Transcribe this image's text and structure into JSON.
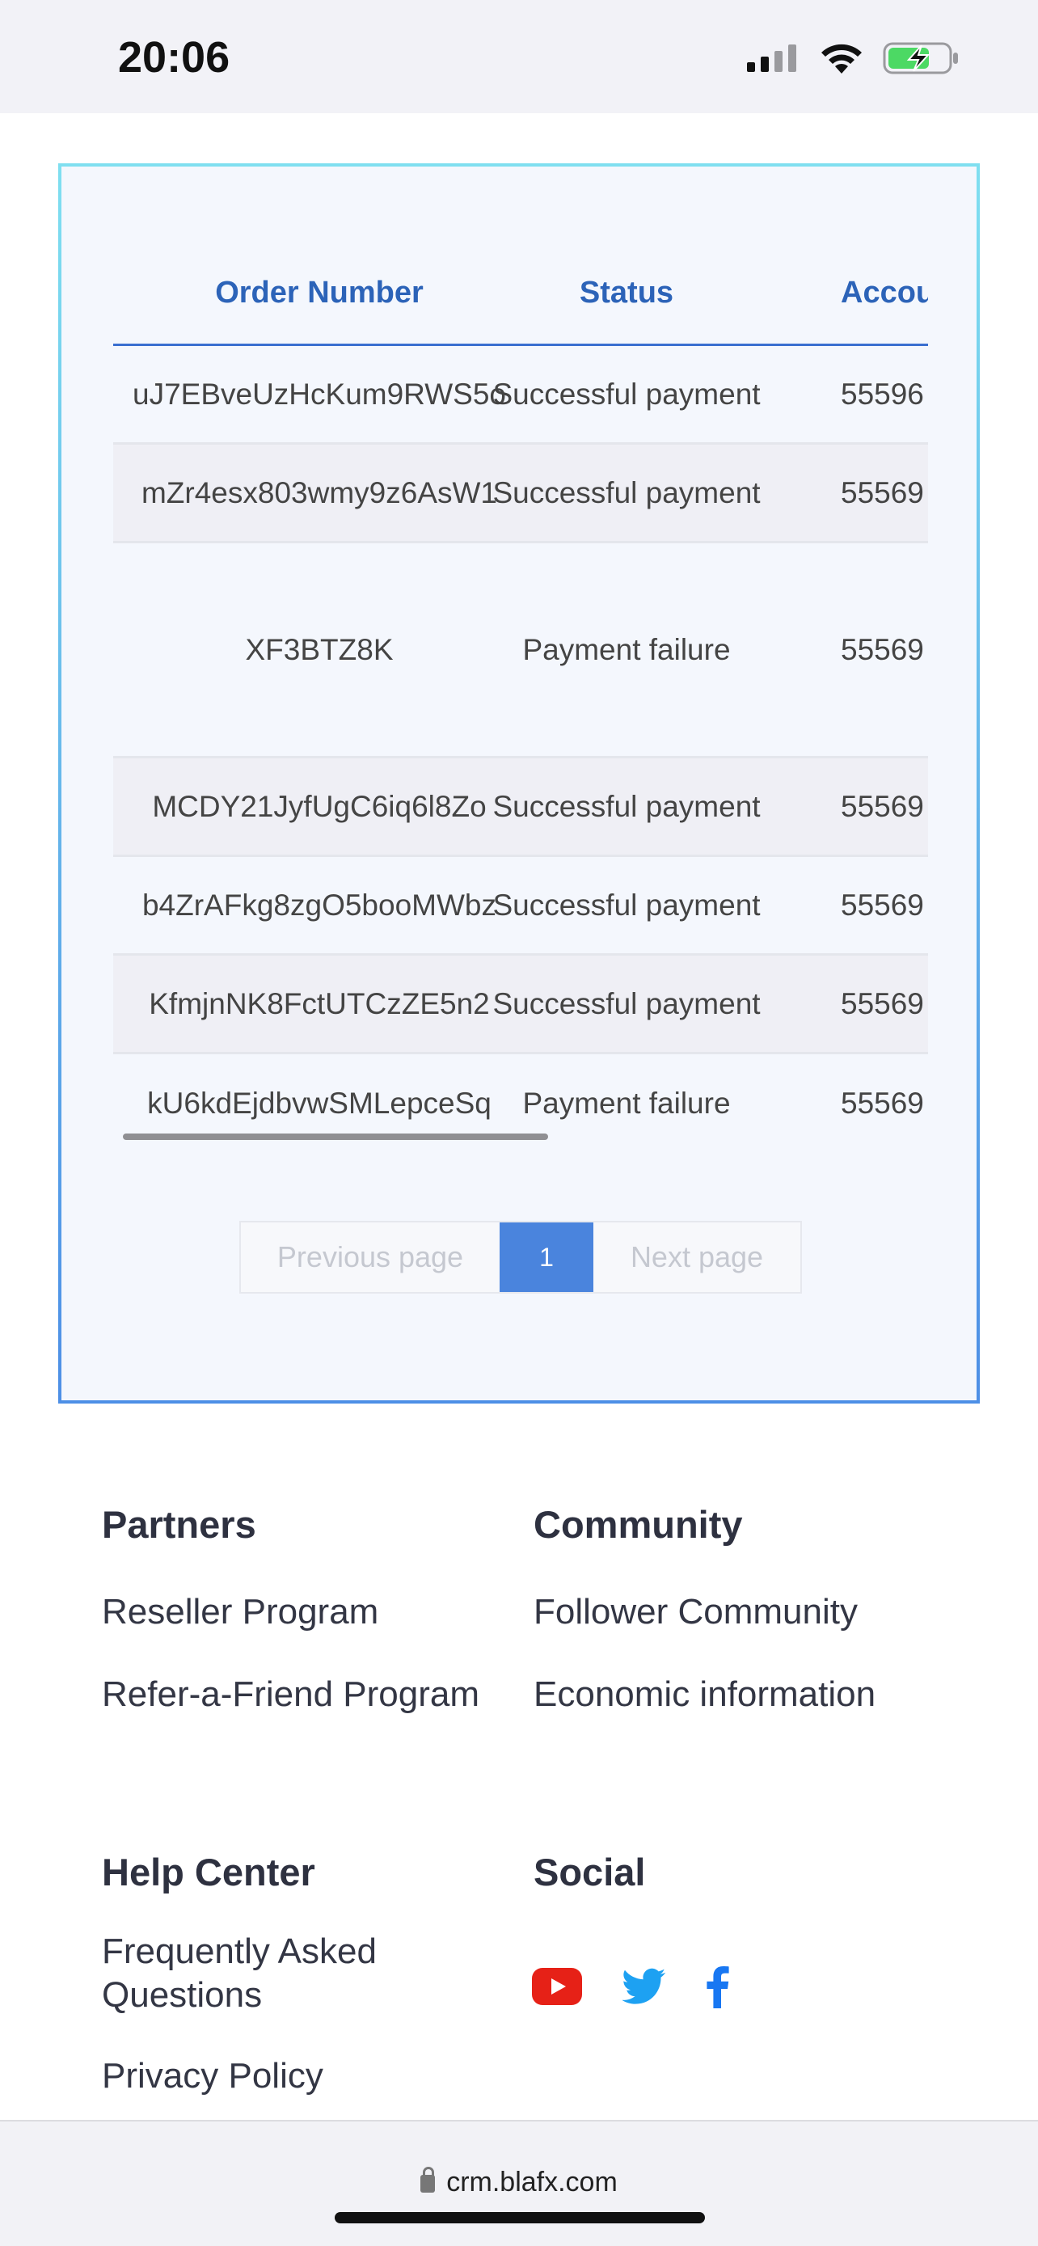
{
  "status_bar": {
    "time": "20:06"
  },
  "table": {
    "headers": {
      "order": "Order Number",
      "status": "Status",
      "account": "Accou"
    },
    "rows": [
      {
        "order": "uJ7EBveUzHcKum9RWS5o",
        "status": "Successful payment",
        "account": "55596"
      },
      {
        "order": "mZr4esx803wmy9z6AsW1",
        "status": "Successful payment",
        "account": "55569"
      },
      {
        "order": "XF3BTZ8K",
        "status": "Payment failure",
        "account": "55569"
      },
      {
        "order": "MCDY21JyfUgC6iq6l8Zo",
        "status": "Successful payment",
        "account": "55569"
      },
      {
        "order": "b4ZrAFkg8zgO5booMWbz",
        "status": "Successful payment",
        "account": "55569"
      },
      {
        "order": "KfmjnNK8FctUTCzZE5n2",
        "status": "Successful payment",
        "account": "55569"
      },
      {
        "order": "kU6kdEjdbvwSMLepceSq",
        "status": "Payment failure",
        "account": "55569"
      }
    ]
  },
  "pagination": {
    "prev_label": "Previous page",
    "current_page": "1",
    "next_label": "Next page"
  },
  "footer": {
    "partners": {
      "title": "Partners",
      "links": [
        "Reseller Program",
        "Refer-a-Friend Program"
      ]
    },
    "community": {
      "title": "Community",
      "links": [
        "Follower Community",
        "Economic information"
      ]
    },
    "help_center": {
      "title": "Help Center",
      "links": [
        "Frequently Asked Questions",
        "Privacy Policy"
      ]
    },
    "social": {
      "title": "Social",
      "icons": [
        "youtube-icon",
        "twitter-icon",
        "facebook-icon"
      ]
    }
  },
  "browser": {
    "url": "crm.blafx.com"
  },
  "colors": {
    "accent": "#2c63b8",
    "page_button": "#4a84dd",
    "youtube": "#e62117",
    "twitter": "#1da1f2",
    "facebook": "#1877f2"
  }
}
